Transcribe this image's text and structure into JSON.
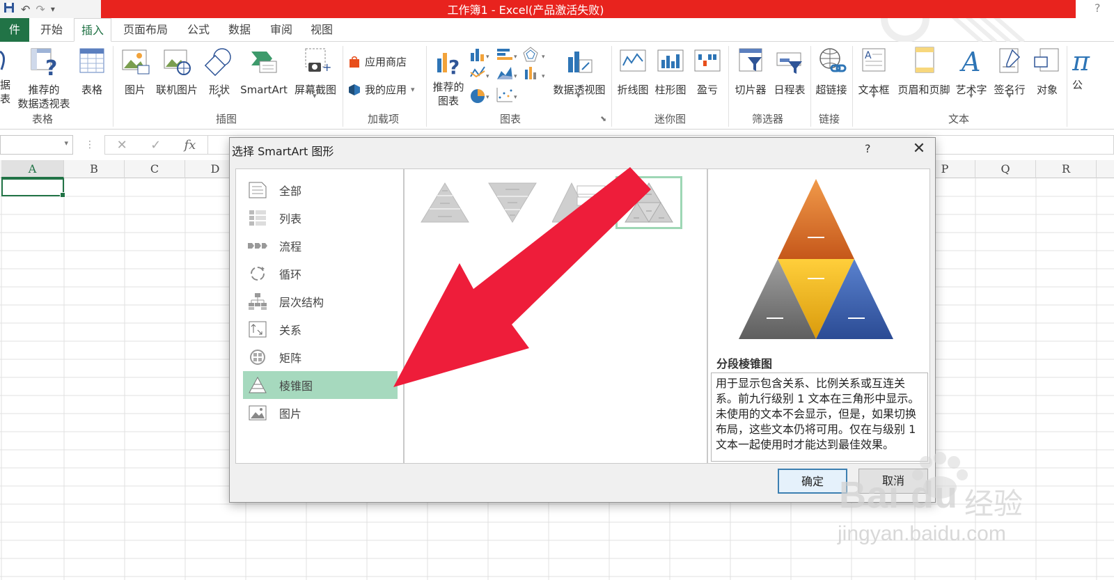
{
  "window": {
    "title": "工作簿1 -  Excel(产品激活失败)",
    "help": "?"
  },
  "tabs": [
    {
      "label": "件"
    },
    {
      "label": "开始"
    },
    {
      "label": "插入"
    },
    {
      "label": "页面布局"
    },
    {
      "label": "公式"
    },
    {
      "label": "数据"
    },
    {
      "label": "审阅"
    },
    {
      "label": "视图"
    }
  ],
  "ribbon": {
    "groups": {
      "tables": "表格",
      "illustrations": "插图",
      "addins": "加载项",
      "charts": "图表",
      "sparklines": "迷你图",
      "filters": "筛选器",
      "links": "链接",
      "text": "文本"
    },
    "buttons": {
      "pivot_partial_1": "据",
      "pivot_partial_2": "表",
      "recommended_pivot_1": "推荐的",
      "recommended_pivot_2": "数据透视表",
      "table": "表格",
      "pictures": "图片",
      "online_pictures": "联机图片",
      "shapes": "形状",
      "smartart": "SmartArt",
      "screenshot": "屏幕截图",
      "store": "应用商店",
      "my_apps": "我的应用",
      "recommended_charts_1": "推荐的",
      "recommended_charts_2": "图表",
      "pivot_chart": "数据透视图",
      "line": "折线图",
      "column": "柱形图",
      "win_loss": "盈亏",
      "slicer": "切片器",
      "timeline": "日程表",
      "hyperlink": "超链接",
      "textbox": "文本框",
      "header_footer": "页眉和页脚",
      "wordart": "艺术字",
      "signature": "签名行",
      "object": "对象",
      "formula_partial": "公"
    }
  },
  "formula_bar": {
    "fx": "fx",
    "cancel": "✕",
    "enter": "✓"
  },
  "columns": [
    "A",
    "B",
    "C",
    "D",
    "P",
    "Q",
    "R"
  ],
  "dialog": {
    "title": "选择 SmartArt 图形",
    "help": "?",
    "close": "✕",
    "categories": [
      {
        "label": "全部",
        "icon": "all-icon"
      },
      {
        "label": "列表",
        "icon": "list-icon"
      },
      {
        "label": "流程",
        "icon": "process-icon"
      },
      {
        "label": "循环",
        "icon": "cycle-icon"
      },
      {
        "label": "层次结构",
        "icon": "hierarchy-icon"
      },
      {
        "label": "关系",
        "icon": "relationship-icon"
      },
      {
        "label": "矩阵",
        "icon": "matrix-icon"
      },
      {
        "label": "棱锥图",
        "icon": "pyramid-icon"
      },
      {
        "label": "图片",
        "icon": "picture-icon"
      }
    ],
    "selected_category": "棱锥图",
    "preview": {
      "title": "分段棱锥图",
      "description": "用于显示包含关系、比例关系或互连关系。前九行级别 1 文本在三角形中显示。未使用的文本不会显示，但是，如果切换布局，这些文本仍将可用。仅在与级别 1 文本一起使用时才能达到最佳效果。",
      "colors": {
        "top": "#e07a2e",
        "center": "#f4b823",
        "left": "#7d7d7d",
        "right": "#3a5da8"
      }
    },
    "ok": "确定",
    "cancel": "取消"
  },
  "annotation": {
    "arrow_color": "#ee1d3a"
  },
  "watermark": {
    "logo": "Bai  du",
    "brand": "经验",
    "url": "jingyan.baidu.com"
  }
}
